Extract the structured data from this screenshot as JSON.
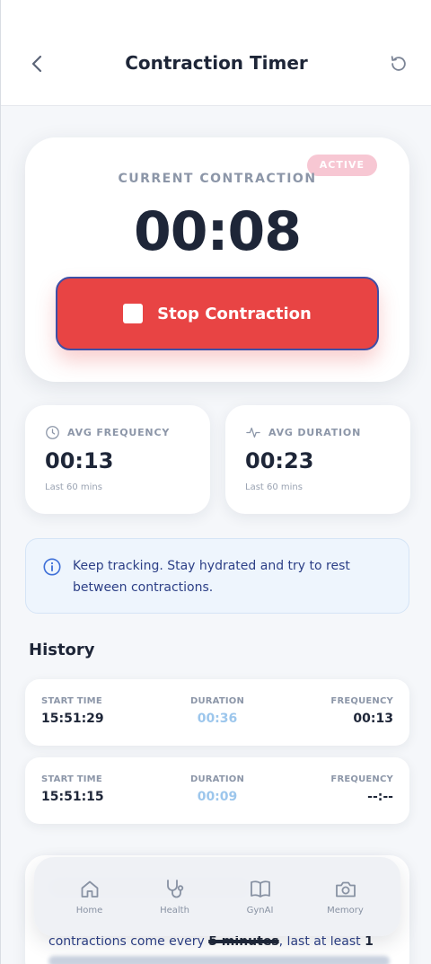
{
  "header": {
    "title": "Contraction Timer"
  },
  "timer_card": {
    "badge": "ACTIVE",
    "label": "CURRENT CONTRACTION",
    "time": "00:08",
    "stop_label": "Stop Contraction"
  },
  "stats": {
    "frequency": {
      "label": "AVG FREQUENCY",
      "value": "00:13",
      "sub": "Last 60 mins"
    },
    "duration": {
      "label": "AVG DURATION",
      "value": "00:23",
      "sub": "Last 60 mins"
    }
  },
  "info": {
    "text": "Keep tracking. Stay hydrated and try to rest between contractions."
  },
  "history": {
    "title": "History",
    "columns": {
      "start": "START TIME",
      "duration": "DURATION",
      "frequency": "FREQUENCY"
    },
    "rows": [
      {
        "start": "15:51:29",
        "duration": "00:36",
        "frequency": "00:13"
      },
      {
        "start": "15:51:15",
        "duration": "00:09",
        "frequency": "--:--"
      }
    ]
  },
  "bottom": {
    "text_pre": "contractions come every ",
    "text_bold1": "5 minutes",
    "text_mid": ", last at least ",
    "text_bold2": "1"
  },
  "tabs": [
    {
      "label": "Home",
      "icon": "home-icon"
    },
    {
      "label": "Health",
      "icon": "stethoscope-icon"
    },
    {
      "label": "GynAI",
      "icon": "book-icon"
    },
    {
      "label": "Memory",
      "icon": "camera-icon"
    }
  ],
  "colors": {
    "accent_red": "#e84444",
    "badge_pink": "#f7c7d3",
    "info_blue": "#2c3f86",
    "duration_blue": "#9cc6ec"
  }
}
